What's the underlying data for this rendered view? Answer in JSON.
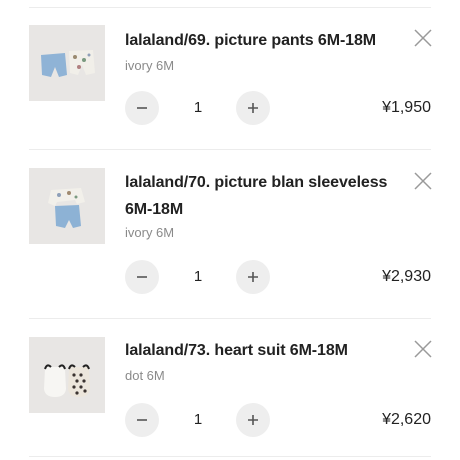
{
  "cart": {
    "items": [
      {
        "name": "lalaland/69. picture pants 6M-18M",
        "option": "ivory 6M",
        "quantity": "1",
        "price": "¥1,950"
      },
      {
        "name": "lalaland/70. picture blan sleeveless 6M-18M",
        "option": "ivory 6M",
        "quantity": "1",
        "price": "¥2,930"
      },
      {
        "name": "lalaland/73. heart suit 6M-18M",
        "option": "dot 6M",
        "quantity": "1",
        "price": "¥2,620"
      }
    ]
  },
  "icons": {
    "remove": "close-icon",
    "decrease": "minus-icon",
    "increase": "plus-icon"
  },
  "colors": {
    "button_bg": "#eeeeee",
    "option_text": "#8a8a8a",
    "divider": "#ececec"
  }
}
